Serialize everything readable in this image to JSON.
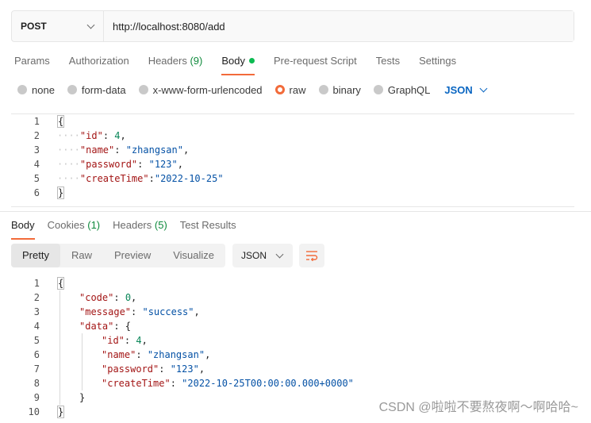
{
  "request": {
    "method": "POST",
    "url": "http://localhost:8080/add"
  },
  "request_tabs": [
    {
      "label": "Params"
    },
    {
      "label": "Authorization"
    },
    {
      "label": "Headers",
      "count": "(9)"
    },
    {
      "label": "Body",
      "active": true
    },
    {
      "label": "Pre-request Script"
    },
    {
      "label": "Tests"
    },
    {
      "label": "Settings"
    }
  ],
  "body_types": [
    "none",
    "form-data",
    "x-www-form-urlencoded",
    "raw",
    "binary",
    "GraphQL"
  ],
  "body_type_selected": "raw",
  "body_language": "JSON",
  "request_body": {
    "line_numbers": [
      "1",
      "2",
      "3",
      "4",
      "5",
      "6"
    ],
    "open_brace": "{",
    "close_brace": "}",
    "fields": [
      {
        "key": "\"id\"",
        "sep": ": ",
        "value": "4",
        "value_type": "num",
        "tail": ","
      },
      {
        "key": "\"name\"",
        "sep": ": ",
        "value": "\"zhangsan\"",
        "value_type": "str",
        "tail": ","
      },
      {
        "key": "\"password\"",
        "sep": ": ",
        "value": "\"123\"",
        "value_type": "str",
        "tail": ","
      },
      {
        "key": "\"createTime\"",
        "sep": ":",
        "value": "\"2022-10-25\"",
        "value_type": "str",
        "tail": ""
      }
    ]
  },
  "response_tabs": [
    {
      "label": "Body",
      "active": true
    },
    {
      "label": "Cookies",
      "count": "(1)"
    },
    {
      "label": "Headers",
      "count": "(5)"
    },
    {
      "label": "Test Results"
    }
  ],
  "view_modes": [
    "Pretty",
    "Raw",
    "Preview",
    "Visualize"
  ],
  "view_mode_selected": "Pretty",
  "response_format": "JSON",
  "response_body": {
    "line_numbers": [
      "1",
      "2",
      "3",
      "4",
      "5",
      "6",
      "7",
      "8",
      "9",
      "10"
    ],
    "lines": [
      {
        "indent": 0,
        "parts": [
          [
            "punc",
            "{"
          ]
        ]
      },
      {
        "indent": 1,
        "parts": [
          [
            "key",
            "\"code\""
          ],
          [
            "punc",
            ": "
          ],
          [
            "num",
            "0"
          ],
          [
            "punc",
            ","
          ]
        ]
      },
      {
        "indent": 1,
        "parts": [
          [
            "key",
            "\"message\""
          ],
          [
            "punc",
            ": "
          ],
          [
            "str",
            "\"success\""
          ],
          [
            "punc",
            ","
          ]
        ]
      },
      {
        "indent": 1,
        "parts": [
          [
            "key",
            "\"data\""
          ],
          [
            "punc",
            ": {"
          ]
        ]
      },
      {
        "indent": 2,
        "parts": [
          [
            "key",
            "\"id\""
          ],
          [
            "punc",
            ": "
          ],
          [
            "num",
            "4"
          ],
          [
            "punc",
            ","
          ]
        ]
      },
      {
        "indent": 2,
        "parts": [
          [
            "key",
            "\"name\""
          ],
          [
            "punc",
            ": "
          ],
          [
            "str",
            "\"zhangsan\""
          ],
          [
            "punc",
            ","
          ]
        ]
      },
      {
        "indent": 2,
        "parts": [
          [
            "key",
            "\"password\""
          ],
          [
            "punc",
            ": "
          ],
          [
            "str",
            "\"123\""
          ],
          [
            "punc",
            ","
          ]
        ]
      },
      {
        "indent": 2,
        "parts": [
          [
            "key",
            "\"createTime\""
          ],
          [
            "punc",
            ": "
          ],
          [
            "str",
            "\"2022-10-25T00:00:00.000+0000\""
          ]
        ]
      },
      {
        "indent": 1,
        "parts": [
          [
            "punc",
            "}"
          ]
        ]
      },
      {
        "indent": 0,
        "parts": [
          [
            "punc",
            "}"
          ]
        ]
      }
    ]
  },
  "watermark": "CSDN @啦啦不要熬夜啊～啊哈哈~",
  "colors": {
    "accent": "#f26b3a",
    "active_dot": "#0cbb52",
    "count_green": "#0f8a3c",
    "json_link": "#0a66c2"
  }
}
